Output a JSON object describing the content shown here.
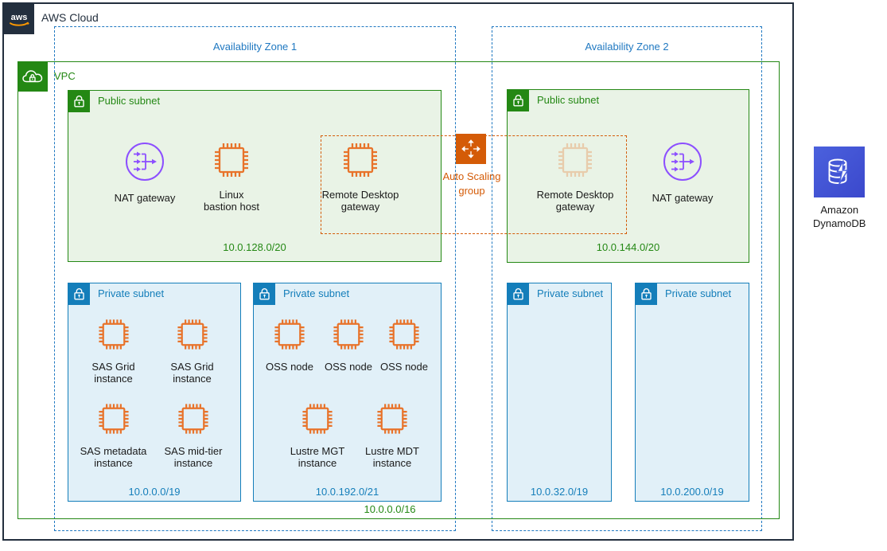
{
  "cloud": {
    "label": "AWS Cloud",
    "logo_icon": "aws-logo-icon"
  },
  "availability_zones": [
    {
      "title": "Availability Zone 1"
    },
    {
      "title": "Availability Zone 2"
    }
  ],
  "vpc": {
    "label": "VPC",
    "icon": "vpc-cloud-lock-icon",
    "cidr": "10.0.0.0/16",
    "color": "#248814"
  },
  "auto_scaling_group": {
    "label": "Auto Scaling\ngroup",
    "icon": "auto-scaling-group-icon",
    "color": "#D45B07"
  },
  "subnets": [
    {
      "id": "az1-public",
      "type": "public",
      "title": "Public subnet",
      "icon": "subnet-lock-icon",
      "cidr": "10.0.128.0/20",
      "nodes": [
        {
          "label": "NAT gateway",
          "icon": "nat-gateway-icon"
        },
        {
          "label": "Linux\nbastion host",
          "icon": "ec2-instance-icon"
        },
        {
          "label": "Remote Desktop\ngateway",
          "icon": "ec2-instance-icon"
        }
      ]
    },
    {
      "id": "az2-public",
      "type": "public",
      "title": "Public subnet",
      "icon": "subnet-lock-icon",
      "cidr": "10.0.144.0/20",
      "nodes": [
        {
          "label": "Remote Desktop\ngateway",
          "icon": "ec2-instance-icon"
        },
        {
          "label": "NAT gateway",
          "icon": "nat-gateway-icon"
        }
      ]
    },
    {
      "id": "az1-private-1",
      "type": "private",
      "title": "Private subnet",
      "icon": "subnet-lock-icon",
      "cidr": "10.0.0.0/19",
      "nodes": [
        {
          "label": "SAS Grid\ninstance",
          "icon": "ec2-instance-icon"
        },
        {
          "label": "SAS Grid\ninstance",
          "icon": "ec2-instance-icon"
        },
        {
          "label": "SAS metadata\ninstance",
          "icon": "ec2-instance-icon"
        },
        {
          "label": "SAS mid-tier\ninstance",
          "icon": "ec2-instance-icon"
        }
      ]
    },
    {
      "id": "az1-private-2",
      "type": "private",
      "title": "Private subnet",
      "icon": "subnet-lock-icon",
      "cidr": "10.0.192.0/21",
      "nodes": [
        {
          "label": "OSS node",
          "icon": "ec2-instance-icon"
        },
        {
          "label": "OSS node",
          "icon": "ec2-instance-icon"
        },
        {
          "label": "OSS node",
          "icon": "ec2-instance-icon"
        },
        {
          "label": "Lustre MGT\ninstance",
          "icon": "ec2-instance-icon"
        },
        {
          "label": "Lustre MDT\ninstance",
          "icon": "ec2-instance-icon"
        }
      ]
    },
    {
      "id": "az2-private-1",
      "type": "private",
      "title": "Private subnet",
      "icon": "subnet-lock-icon",
      "cidr": "10.0.32.0/19",
      "nodes": []
    },
    {
      "id": "az2-private-2",
      "type": "private",
      "title": "Private subnet",
      "icon": "subnet-lock-icon",
      "cidr": "10.0.200.0/19",
      "nodes": []
    }
  ],
  "external_services": [
    {
      "label": "Amazon\nDynamoDB",
      "icon": "amazon-dynamodb-icon",
      "color": "#4B61DD"
    }
  ],
  "colors": {
    "aws_navy": "#232F3E",
    "vpc_green": "#248814",
    "subnet_blue": "#147EBA",
    "az_blue": "#1F78C1",
    "compute_orange": "#E8732A",
    "asg_orange": "#D45B07",
    "networking_purple": "#8C4FFF"
  }
}
